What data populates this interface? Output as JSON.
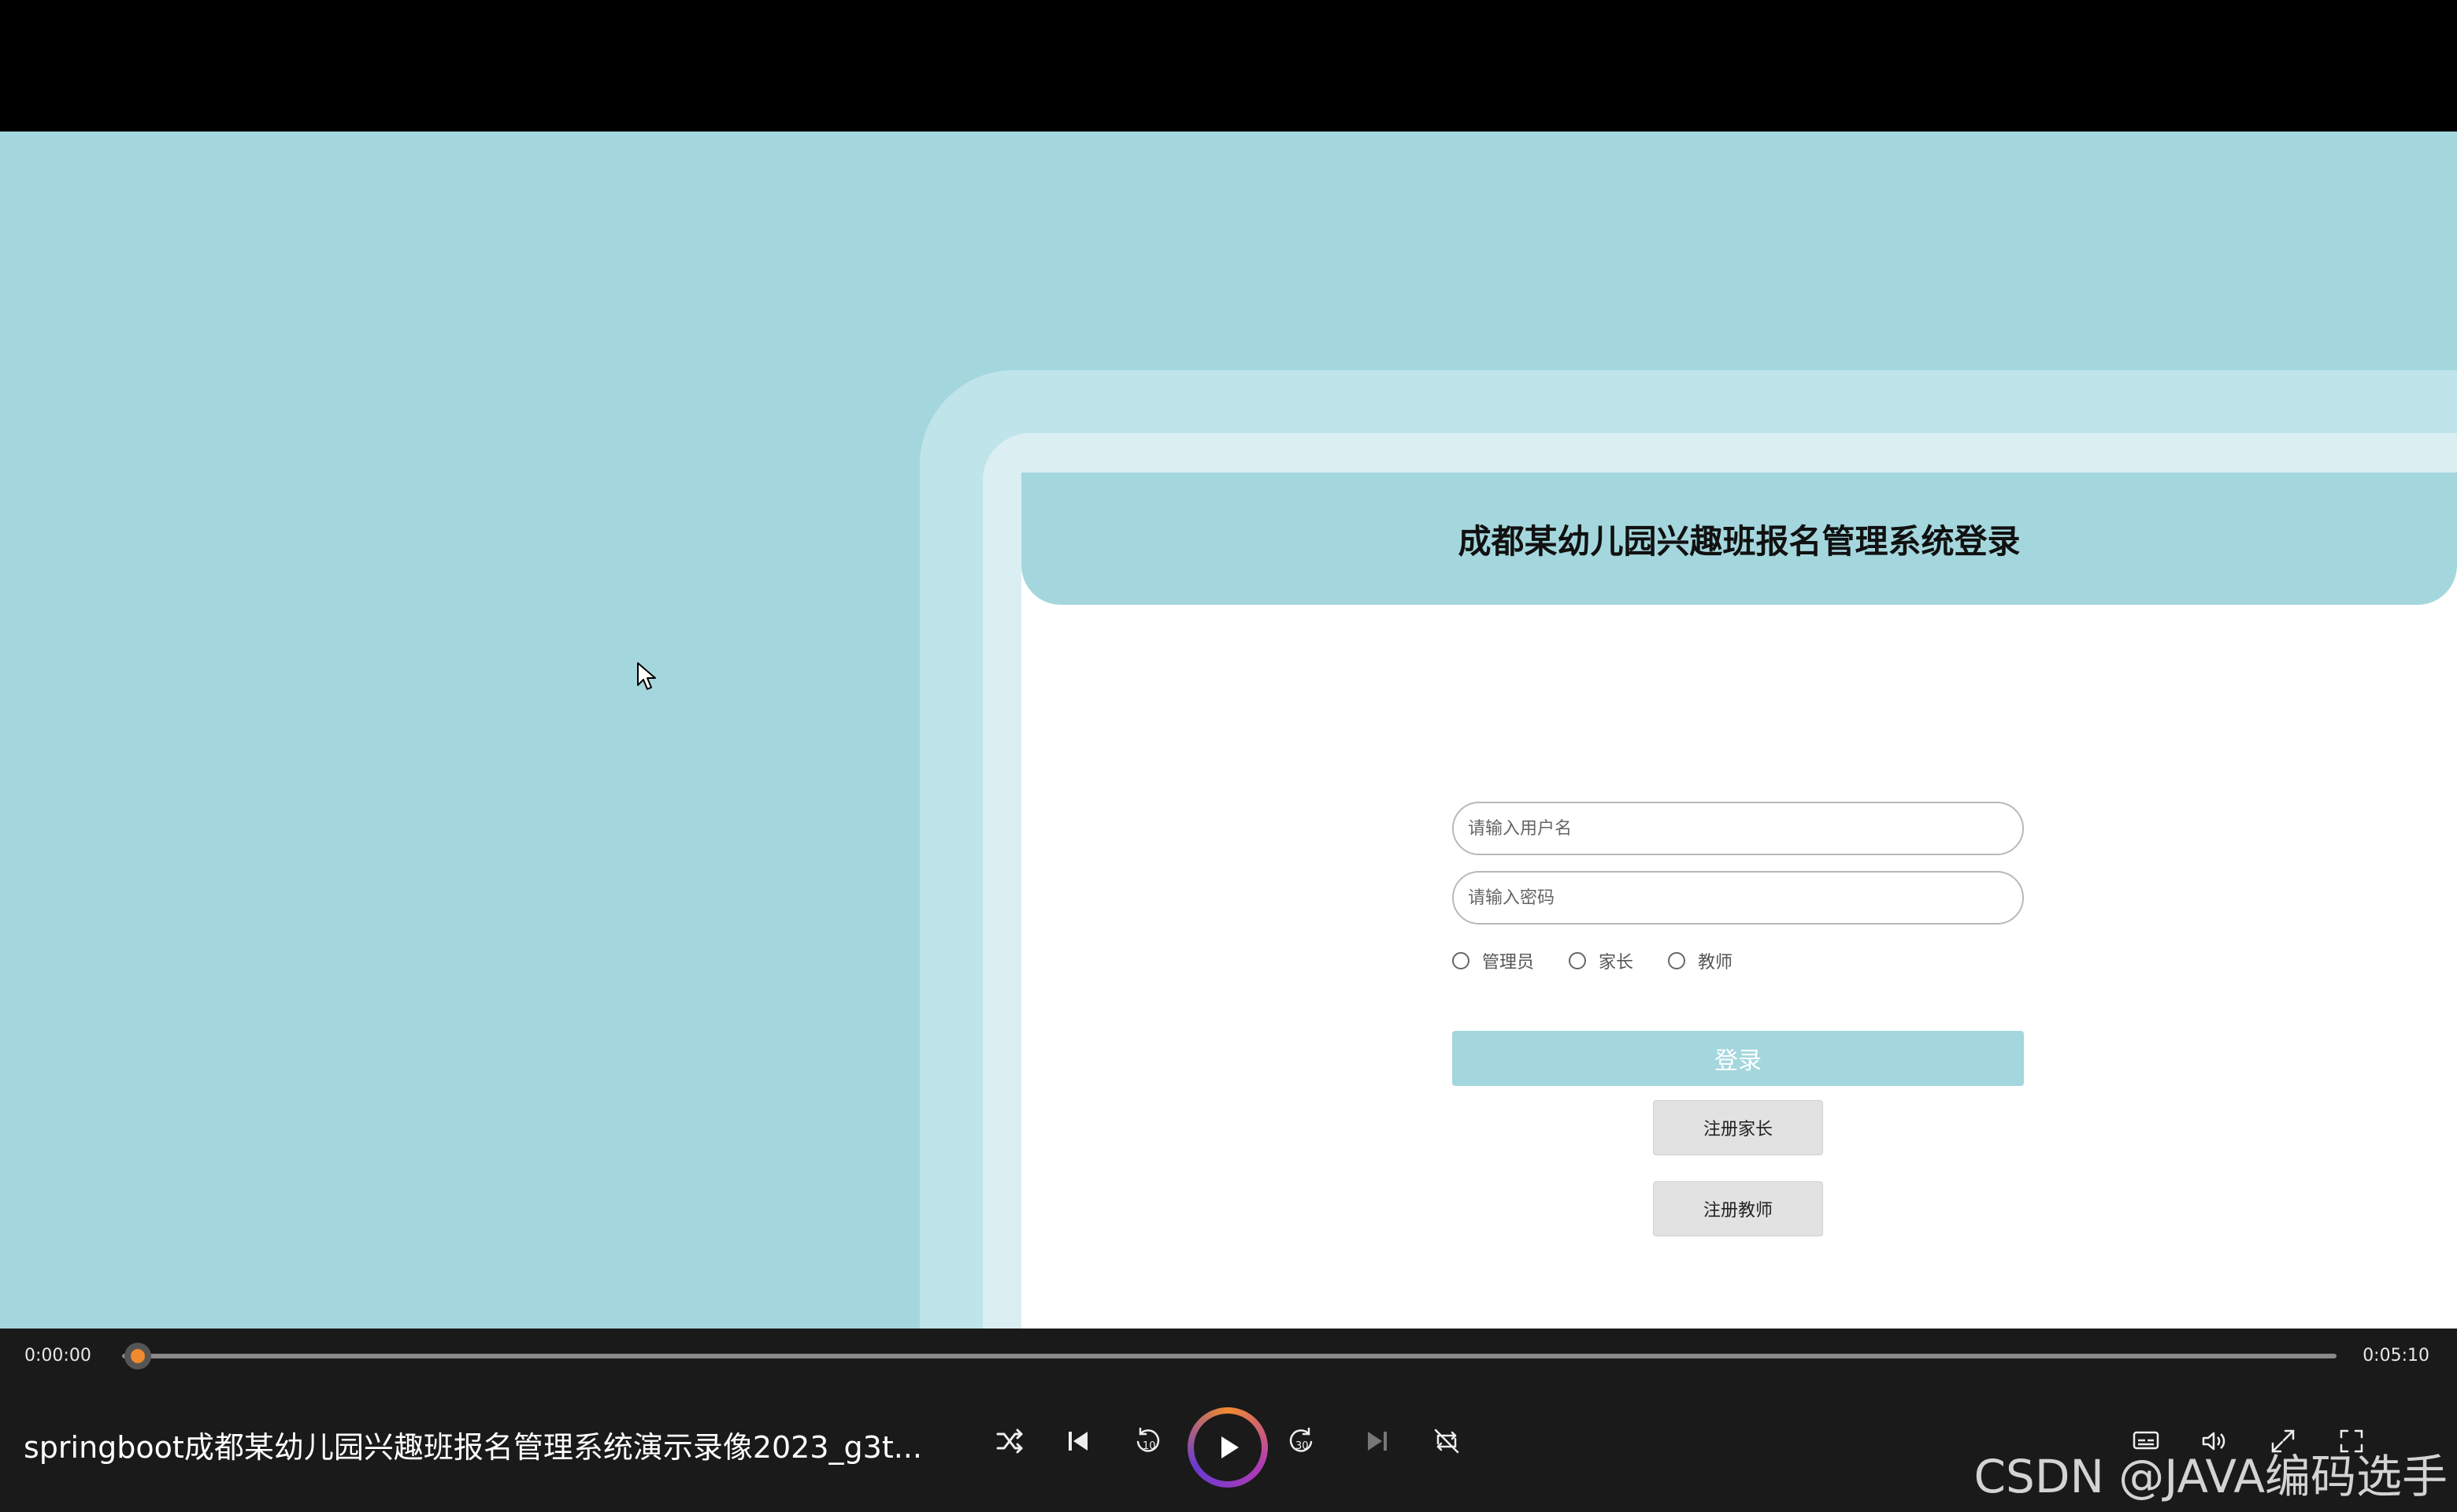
{
  "login": {
    "title": "成都某幼儿园兴趣班报名管理系统登录",
    "username_placeholder": "请输入用户名",
    "password_placeholder": "请输入密码",
    "roles": [
      "管理员",
      "家长",
      "教师"
    ],
    "login_button": "登录",
    "register_parent_button": "注册家长",
    "register_teacher_button": "注册教师"
  },
  "player": {
    "current_time": "0:00:00",
    "total_time": "0:05:10",
    "progress": 0.0,
    "video_title": "springboot成都某幼儿园兴趣班报名管理系统演示录像2023_g3t...",
    "icons": [
      "shuffle-icon",
      "previous-icon",
      "rewind-10-icon",
      "play-icon",
      "forward-30-icon",
      "next-icon",
      "repeat-off-icon",
      "subtitles-icon",
      "volume-icon",
      "expand-icon",
      "fullscreen-icon"
    ]
  },
  "watermark": "CSDN @JAVA编码选手",
  "colors": {
    "accent": "#a4d7dd",
    "progress_thumb": "#f08a2e"
  }
}
